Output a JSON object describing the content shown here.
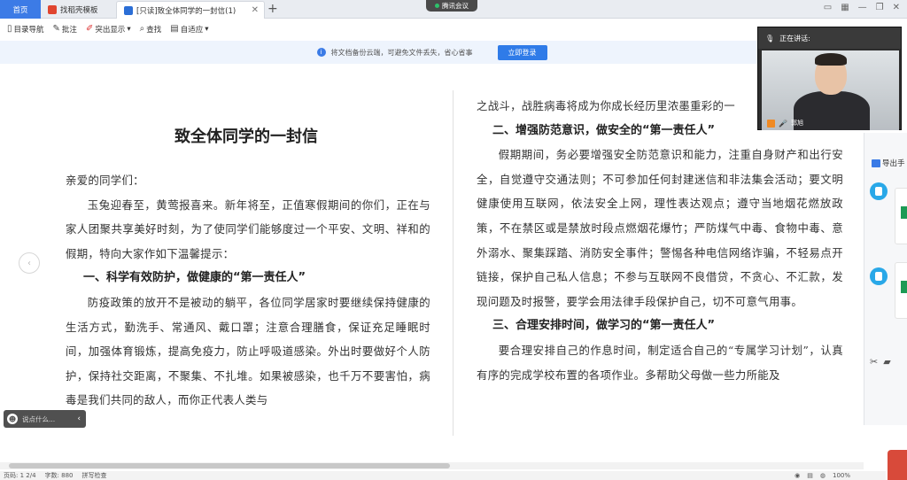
{
  "tabs": [
    {
      "label": "首页",
      "active": false
    },
    {
      "label": "找稻壳模板",
      "active": false
    },
    {
      "label": "[只读]致全体同学的一封信(1)",
      "active": true
    }
  ],
  "meeting_tag": "腾讯会议",
  "toolbar": {
    "nav": "目录导航",
    "annotate": "批注",
    "highlight": "突出显示",
    "find": "查找",
    "fit": "自适应"
  },
  "notice": {
    "text": "将文档备份云端，可避免文件丢失，省心省事",
    "login": "立即登录"
  },
  "document": {
    "title": "致全体同学的一封信",
    "left": [
      {
        "type": "p",
        "text": "亲爱的同学们："
      },
      {
        "type": "pi",
        "text": "玉兔迎春至，黄莺报喜来。新年将至，正值寒假期间的你们，正在与家人团聚共享美好时刻，为了使同学们能够度过一个平安、文明、祥和的假期，特向大家作如下温馨提示："
      },
      {
        "type": "h",
        "text": "一、科学有效防护，做健康的“第一责任人”"
      },
      {
        "type": "pi",
        "text": "防疫政策的放开不是被动的躺平，各位同学居家时要继续保持健康的生活方式，勤洗手、常通风、戴口罩；注意合理膳食，保证充足睡眠时间，加强体育锻炼，提高免疫力，防止呼吸道感染。外出时要做好个人防护，保持社交距离，不聚集、不扎堆。如果被感染，也千万不要害怕，病毒是我们共同的敌人，而你正代表人类与"
      }
    ],
    "right": [
      {
        "type": "p",
        "text": "之战斗，战胜病毒将成为你成长经历里浓墨重彩的一"
      },
      {
        "type": "h",
        "text": "二、增强防范意识，做安全的“第一责任人”"
      },
      {
        "type": "pi",
        "text": "假期期间，务必要增强安全防范意识和能力，注重自身财产和出行安全，自觉遵守交通法则；不可参加任何封建迷信和非法集会活动；要文明健康使用互联网，依法安全上网，理性表达观点；遵守当地烟花燃放政策，不在禁区或是禁放时段点燃烟花爆竹；严防煤气中毒、食物中毒、意外溺水、聚集踩踏、消防安全事件；警惕各种电信网络诈骗，不轻易点开链接，保护自己私人信息；不参与互联网不良借贷，不贪心、不汇款，发现问题及时报警，要学会用法律手段保护自己，切不可意气用事。"
      },
      {
        "type": "h",
        "text": "三、合理安排时间，做学习的“第一责任人”"
      },
      {
        "type": "pi",
        "text": "要合理安排自己的作息时间，制定适合自己的“专属学习计划”，认真有序的完成学校布置的各项作业。多帮助父母做一些力所能及"
      }
    ]
  },
  "chat": {
    "placeholder": "说点什么..."
  },
  "video": {
    "speaking_label": "正在讲话:",
    "user_name": "郭旭"
  },
  "side_panel": {
    "export_label": "导出手"
  },
  "statusbar": {
    "page": "页码: 1  2/4",
    "words": "字数: 880",
    "spell": "拼写检查",
    "zoom": "100%"
  },
  "colors": {
    "accent": "#2f7be8",
    "notice_bg": "#eef4fd",
    "tab_home": "#3c7be6"
  }
}
